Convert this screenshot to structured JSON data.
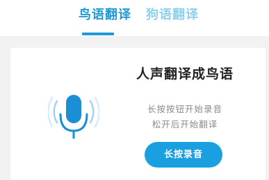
{
  "tabs": [
    {
      "label": "鸟语翻译",
      "active": true
    },
    {
      "label": "狗语翻译",
      "active": false
    }
  ],
  "card": {
    "title": "人声翻译成鸟语",
    "instructions": [
      "长按按钮开始录音",
      "松开后开始翻译"
    ],
    "record_button_label": "长按录音"
  },
  "icons": {
    "microphone": "microphone-icon"
  },
  "colors": {
    "accent": "#1e9ad6",
    "accent_light": "#8dd0ee",
    "button": "#1aa0e0",
    "background": "#f2f2f2",
    "card": "#ffffff",
    "title_text": "#222222",
    "secondary_text": "#8a8a8a"
  }
}
